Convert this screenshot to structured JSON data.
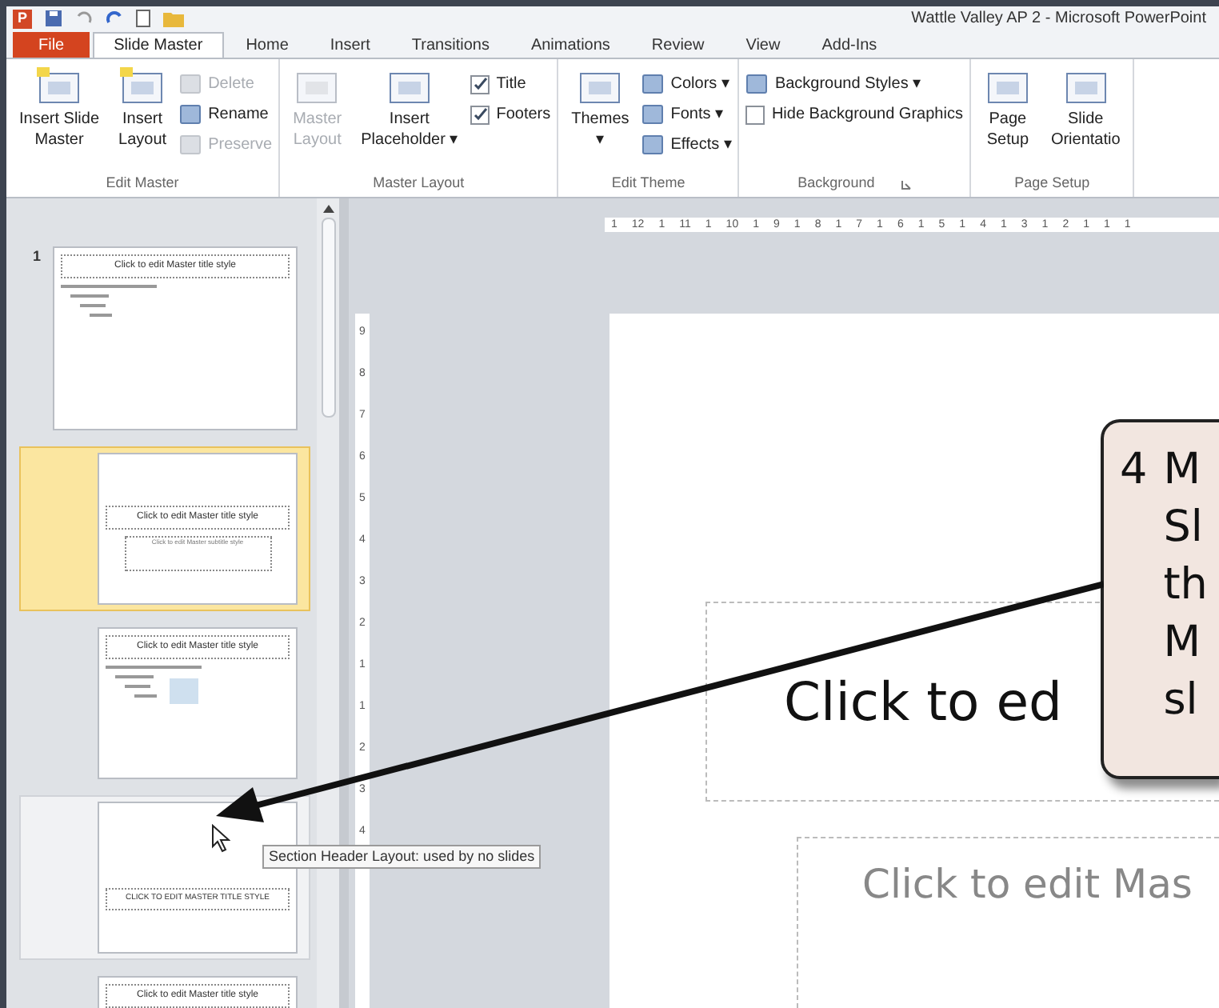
{
  "window": {
    "logo": "P",
    "title": "Wattle Valley AP 2 - Microsoft PowerPoint"
  },
  "tabs": [
    {
      "label": "File",
      "kind": "file",
      "selected": false
    },
    {
      "label": "Slide Master",
      "kind": "tab",
      "selected": true
    },
    {
      "label": "Home",
      "kind": "tab",
      "selected": false
    },
    {
      "label": "Insert",
      "kind": "tab",
      "selected": false
    },
    {
      "label": "Transitions",
      "kind": "tab",
      "selected": false
    },
    {
      "label": "Animations",
      "kind": "tab",
      "selected": false
    },
    {
      "label": "Review",
      "kind": "tab",
      "selected": false
    },
    {
      "label": "View",
      "kind": "tab",
      "selected": false
    },
    {
      "label": "Add-Ins",
      "kind": "tab",
      "selected": false
    }
  ],
  "ribbon": {
    "groups": [
      {
        "label": "Edit Master",
        "columns": [
          [
            {
              "kind": "large",
              "lines": [
                "Insert Slide",
                "Master"
              ],
              "disabled": false
            }
          ],
          [
            {
              "kind": "large",
              "lines": [
                "Insert",
                "Layout"
              ],
              "disabled": false
            }
          ],
          [
            {
              "kind": "small",
              "label": "Delete",
              "disabled": true
            },
            {
              "kind": "small",
              "label": "Rename",
              "disabled": false
            },
            {
              "kind": "small",
              "label": "Preserve",
              "disabled": true
            }
          ]
        ]
      },
      {
        "label": "Master Layout",
        "columns": [
          [
            {
              "kind": "large",
              "lines": [
                "Master",
                "Layout"
              ],
              "disabled": true
            }
          ],
          [
            {
              "kind": "large",
              "lines": [
                "Insert",
                "Placeholder ▾"
              ],
              "disabled": false
            }
          ],
          [
            {
              "kind": "check",
              "label": "Title",
              "checked": true
            },
            {
              "kind": "check",
              "label": "Footers",
              "checked": true
            }
          ]
        ]
      },
      {
        "label": "Edit Theme",
        "columns": [
          [
            {
              "kind": "large",
              "lines": [
                "Themes",
                "▾"
              ],
              "disabled": false
            }
          ],
          [
            {
              "kind": "small",
              "label": "Colors ▾",
              "disabled": false
            },
            {
              "kind": "small",
              "label": "Fonts ▾",
              "disabled": false
            },
            {
              "kind": "small",
              "label": "Effects ▾",
              "disabled": false
            }
          ]
        ]
      },
      {
        "label": "Background",
        "launcher": true,
        "columns": [
          [
            {
              "kind": "small",
              "label": "Background Styles ▾",
              "disabled": false
            },
            {
              "kind": "check",
              "label": "Hide Background Graphics",
              "checked": false
            }
          ]
        ]
      },
      {
        "label": "Page Setup",
        "columns": [
          [
            {
              "kind": "large",
              "lines": [
                "Page",
                "Setup"
              ],
              "disabled": false
            }
          ],
          [
            {
              "kind": "large",
              "lines": [
                "Slide",
                "Orientatio"
              ],
              "disabled": false
            }
          ]
        ]
      }
    ]
  },
  "ruler": {
    "horizontal": [
      "1",
      "12",
      "1",
      "11",
      "1",
      "10",
      "1",
      "9",
      "1",
      "8",
      "1",
      "7",
      "1",
      "6",
      "1",
      "5",
      "1",
      "4",
      "1",
      "3",
      "1",
      "2",
      "1",
      "1",
      "1"
    ],
    "vertical": [
      "9",
      "8",
      "7",
      "6",
      "5",
      "4",
      "3",
      "2",
      "1",
      "1",
      "2",
      "3",
      "4"
    ]
  },
  "thumbnails": [
    {
      "number": "1",
      "kind": "master",
      "title": "Click to edit Master title style",
      "selected": false,
      "hovered": false
    },
    {
      "kind": "title",
      "title": "Click to edit Master title style",
      "subtitle": "Click to edit Master subtitle style",
      "selected": true,
      "hovered": false
    },
    {
      "kind": "content",
      "title": "Click to edit Master title style",
      "selected": false,
      "hovered": false
    },
    {
      "kind": "section",
      "title": "CLICK TO EDIT MASTER TITLE STYLE",
      "selected": false,
      "hovered": true
    },
    {
      "kind": "partial",
      "title": "Click to edit Master title style",
      "selected": false,
      "hovered": false
    }
  ],
  "tooltip": "Section Header Layout: used by no slides",
  "slide": {
    "title": "Click to ed",
    "subtitle": "Click to edit Mas"
  },
  "callout": {
    "number": "4",
    "lines": [
      "M",
      "Sl",
      "th",
      "M",
      "sl"
    ]
  }
}
